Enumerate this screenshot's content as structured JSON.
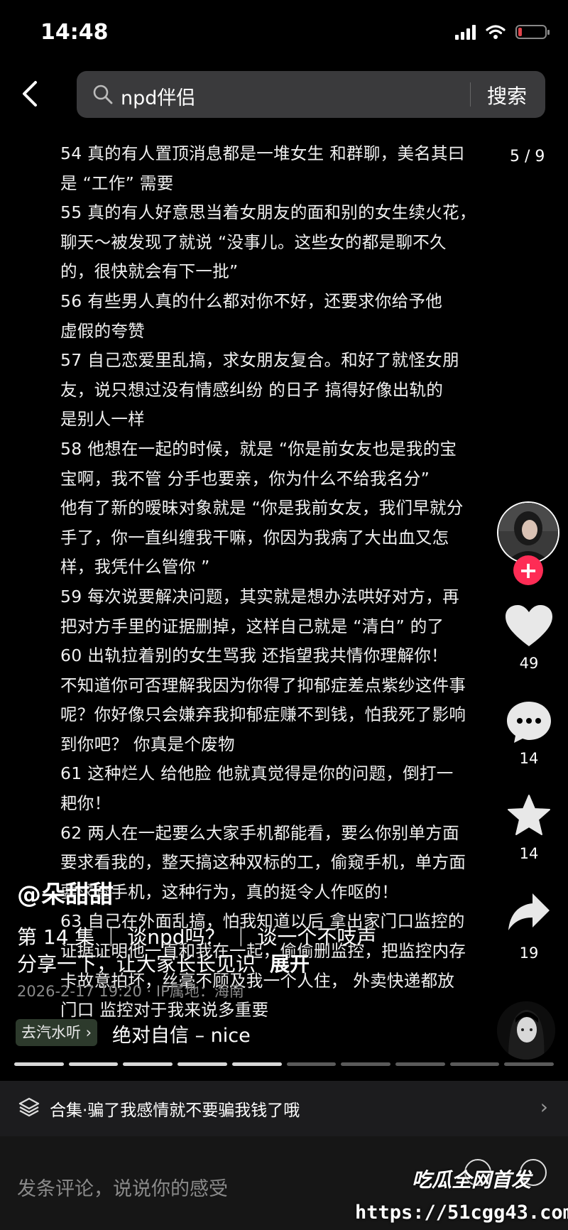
{
  "status_bar": {
    "time": "14:48"
  },
  "search": {
    "query": "npd伴侣",
    "submit_label": "搜索"
  },
  "page_indicator": "5 / 9",
  "caption_lines": [
    "54  真的有人置顶消息都是一堆女生 和群聊，美名其曰",
    "是 “工作” 需要",
    "55 真的有人好意思当着女朋友的面和别的女生续火花，",
    "聊天～被发现了就说 “没事儿。这些女的都是聊不久",
    "的，很快就会有下一批”",
    "56 有些男人真的什么都对你不好，还要求你给予他",
    "虚假的夸赞",
    "57 自己恋爱里乱搞，求女朋友复合。和好了就怪女朋",
    "友，说只想过没有情感纠纷  的日子   搞得好像出轨的",
    "是别人一样",
    "58  他想在一起的时候，就是 “你是前女友也是我的宝",
    "宝啊，我不管 分手也要亲，你为什么不给我名分”",
    "他有了新的暧昧对象就是 “你是我前女友，我们早就分",
    "手了，你一直纠缠我干嘛，你因为我病了大出血又怎",
    "样，我凭什么管你 ”",
    "59  每次说要解决问题，其实就是想办法哄好对方，再",
    "把对方手里的证据删掉，这样自己就是 “清白” 的了",
    "60  出轨拉着别的女生骂我 还指望我共情你理解你！",
    "不知道你可否理解我因为你得了抑郁症差点紫纱这件事",
    "呢？你好像只会嫌弃我抑郁症赚不到钱，怕我死了影响",
    "到你吧？   你真是个废物",
    "61  这种烂人 给他脸 他就真觉得是你的问题，倒打一",
    "耙你！",
    "62   两人在一起要么大家手机都能看，要么你别单方面",
    "要求看我的，整天搞这种双标的工，偷窥手机，单方面",
    "要求查手机，这种行为，真的挺令人作呕的！",
    "63  自己在外面乱搞，怕我知道以后 拿出家门口监控的",
    "证据证明他一直和我在一起，偷偷删监控，把监控内存",
    "卡故意拍坏，丝毫不顾及我一个人住，  外卖快递都放",
    "门口  监控对于我来说多重要"
  ],
  "actions": {
    "like_count": "49",
    "comment_count": "14",
    "favorite_count": "14",
    "share_count": "19",
    "follow_label": "+"
  },
  "author": {
    "name": "@朵甜甜"
  },
  "description": {
    "line1": "第 14 集 ｜ 谈npd吗？ ｜ 谈一个不吱声",
    "line2": "分享一下，让大家长长见识",
    "expand_label": "展开",
    "meta": "2026-2-17 19:20 · IP属地：海南"
  },
  "music": {
    "tag_label": "去汽水听 ›",
    "title": "绝对自信 – nice"
  },
  "progress": {
    "segments_total": 10,
    "segments_done": 5
  },
  "collection": {
    "label": "合集·骗了我感情就不要骗我钱了哦",
    "chevron": "›"
  },
  "comment": {
    "placeholder": "发条评论，说说你的感受"
  },
  "watermark": {
    "logo_text": "吃瓜全网首发",
    "url": "https://51cgg43.com"
  },
  "colors": {
    "follow_accent": "#fe2c55",
    "background": "#000000"
  }
}
